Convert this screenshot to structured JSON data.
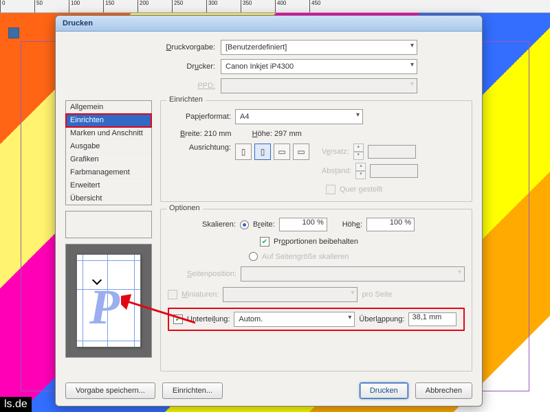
{
  "dialog": {
    "title": "Drucken",
    "preset_label": "Druckvorgabe:",
    "preset_value": "[Benutzerdefiniert]",
    "printer_label": "Drucker:",
    "printer_value": "Canon Inkjet iP4300",
    "ppd_label": "PPD:",
    "ppd_value": ""
  },
  "nav": {
    "items": [
      "Allgemein",
      "Einrichten",
      "Marken und Anschnitt",
      "Ausgabe",
      "Grafiken",
      "Farbmanagement",
      "Erweitert",
      "Übersicht"
    ],
    "selected_index": 1
  },
  "setup": {
    "section_title": "Einrichten",
    "paperformat_label": "Papierformat:",
    "paperformat_value": "A4",
    "width_label": "Breite:",
    "width_value": "210 mm",
    "height_label": "Höhe:",
    "height_value": "297 mm",
    "orientation_label": "Ausrichtung:",
    "offset_label": "Versatz:",
    "offset_value": "",
    "gap_label": "Abstand:",
    "gap_value": "",
    "transverse_label": "Quer gestellt"
  },
  "options": {
    "section_title": "Optionen",
    "scale_label": "Skalieren:",
    "width_label": "Breite:",
    "width_value": "100 %",
    "height_label": "Höhe:",
    "height_value": "100 %",
    "keep_proportions_label": "Proportionen beibehalten",
    "scale_to_page_label": "Auf Seitengröße skalieren",
    "page_position_label": "Seitenposition:",
    "page_position_value": "",
    "thumbnails_label": "Miniaturen:",
    "per_page_label": "pro Seite",
    "tiling_label": "Unterteilung:",
    "tiling_value": "Autom.",
    "overlap_label": "Überlappung:",
    "overlap_value": "38,1 mm"
  },
  "buttons": {
    "save_preset": "Vorgabe speichern...",
    "page_setup": "Einrichten...",
    "print": "Drucken",
    "cancel": "Abbrechen"
  },
  "footer": "ls.de",
  "ruler": [
    "0",
    "50",
    "100",
    "150",
    "200",
    "250",
    "300",
    "350",
    "400",
    "450"
  ]
}
